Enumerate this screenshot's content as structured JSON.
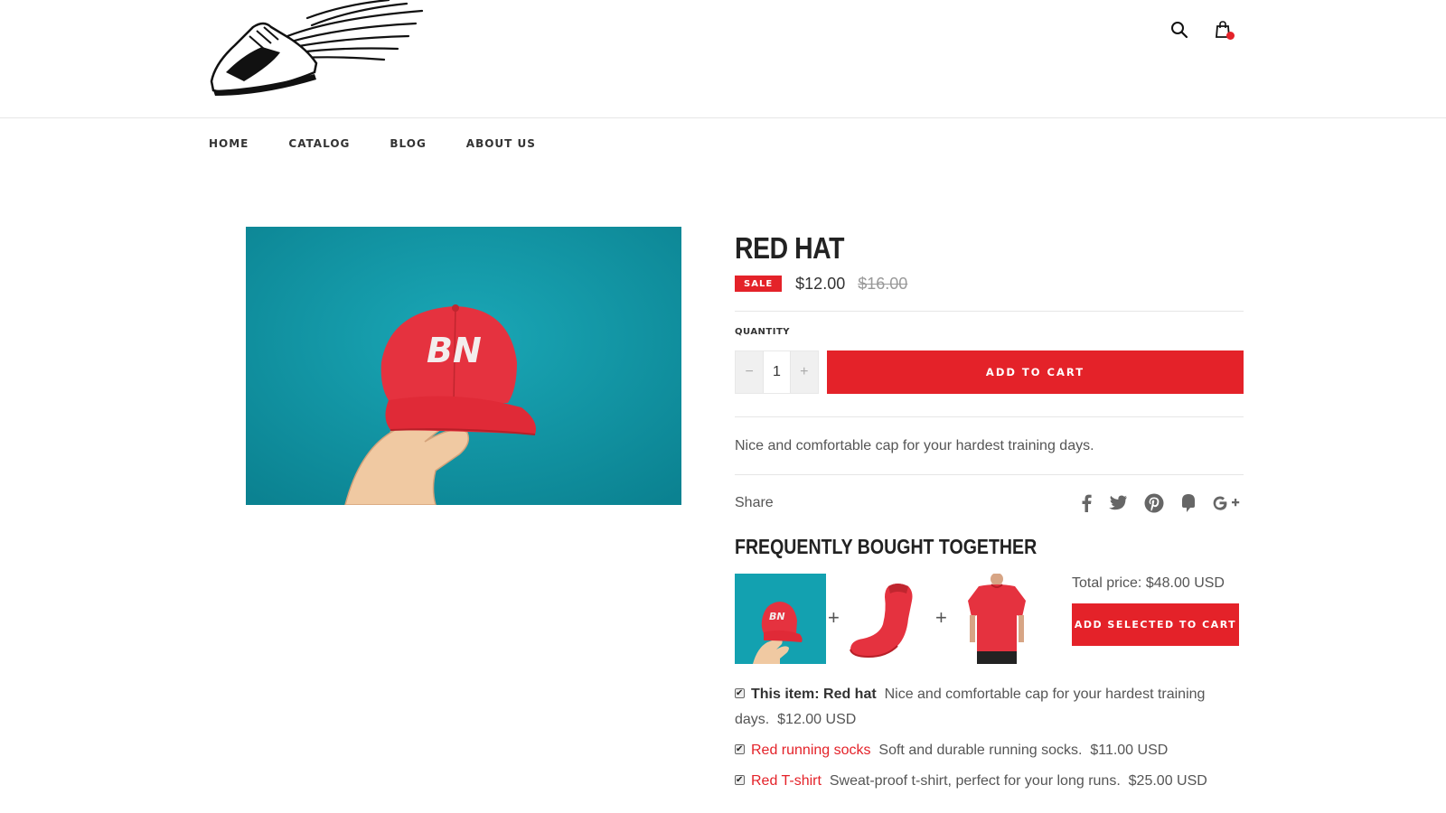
{
  "header": {
    "logo": "winged-shoe-logo"
  },
  "nav": {
    "items": [
      "HOME",
      "CATALOG",
      "BLOG",
      "ABOUT US"
    ]
  },
  "product": {
    "title": "RED HAT",
    "sale_badge": "SALE",
    "price": "$12.00",
    "compare_price": "$16.00",
    "quantity_label": "QUANTITY",
    "quantity": "1",
    "minus": "−",
    "plus": "+",
    "add_to_cart": "ADD TO CART",
    "description": "Nice and comfortable cap for your hardest training days."
  },
  "share": {
    "label": "Share",
    "icons": [
      "facebook-icon",
      "twitter-icon",
      "pinterest-icon",
      "fancy-icon",
      "google-plus-icon"
    ]
  },
  "fbt": {
    "title": "FREQUENTLY BOUGHT TOGETHER",
    "plus": "+",
    "total_price": "Total price: $48.00 USD",
    "add_selected": "ADD SELECTED TO CART",
    "items": [
      {
        "prefix": "This item: Red hat",
        "desc": "Nice and comfortable cap for your hardest training days.",
        "price": "$12.00 USD"
      },
      {
        "name": "Red running socks",
        "desc": "Soft and durable running socks.",
        "price": "$11.00 USD"
      },
      {
        "name": "Red T-shirt",
        "desc": "Sweat-proof t-shirt, perfect for your long runs.",
        "price": "$25.00 USD"
      }
    ]
  },
  "colors": {
    "accent": "#e42229",
    "image_bg": "#14a0ad"
  }
}
